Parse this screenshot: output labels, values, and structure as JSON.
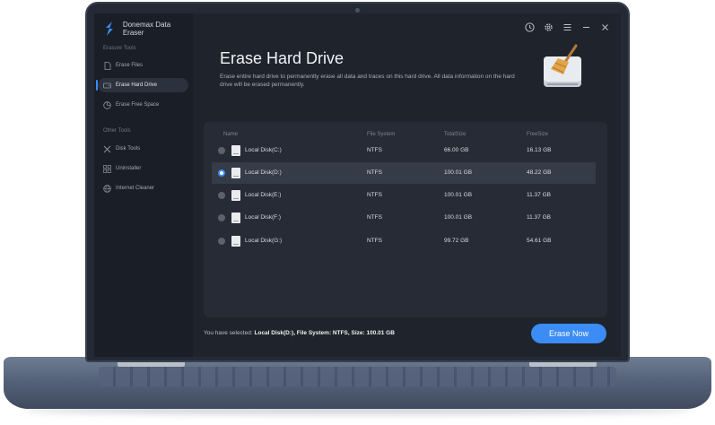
{
  "app": {
    "title": "Donemax Data Eraser"
  },
  "sidebar": {
    "section_erasure": "Erasure Tools",
    "section_other": "Other Tools",
    "erasure_items": [
      {
        "label": "Erase Files",
        "icon": "document-icon",
        "active": false
      },
      {
        "label": "Erase Hard Drive",
        "icon": "drive-icon",
        "active": true
      },
      {
        "label": "Erase Free Space",
        "icon": "pie-chart-icon",
        "active": false
      }
    ],
    "other_items": [
      {
        "label": "Disk Tools",
        "icon": "tools-icon"
      },
      {
        "label": "Uninstaller",
        "icon": "grid-icon"
      },
      {
        "label": "Internet Cleaner",
        "icon": "globe-icon"
      }
    ]
  },
  "toolbar": {
    "icons": [
      "clock-icon",
      "gear-icon",
      "menu-icon",
      "minimize-icon",
      "close-icon"
    ]
  },
  "main": {
    "title": "Erase Hard Drive",
    "description": "Erase entire hard drive to permanently erase all data and traces on this hard drive. All data information on the hard drive will be erased permanently.",
    "hero_icon": "broom-drive-icon"
  },
  "table": {
    "headers": {
      "name": "Name",
      "fs": "File System",
      "total": "TotalSize",
      "free": "FreeSize"
    },
    "rows": [
      {
        "name": "Local Disk(C:)",
        "fs": "NTFS",
        "total": "66.00 GB",
        "free": "16.13 GB",
        "selected": false
      },
      {
        "name": "Local Disk(D:)",
        "fs": "NTFS",
        "total": "100.01 GB",
        "free": "48.22 GB",
        "selected": true
      },
      {
        "name": "Local Disk(E:)",
        "fs": "NTFS",
        "total": "100.01 GB",
        "free": "11.37 GB",
        "selected": false
      },
      {
        "name": "Local Disk(F:)",
        "fs": "NTFS",
        "total": "100.01 GB",
        "free": "11.37 GB",
        "selected": false
      },
      {
        "name": "Local Disk(G:)",
        "fs": "NTFS",
        "total": "99.72 GB",
        "free": "54.61 GB",
        "selected": false
      }
    ]
  },
  "footer": {
    "selected_prefix": "You have selected: ",
    "selected_value": "Local Disk(D:), File System: NTFS, Size: 100.01 GB",
    "erase_button": "Erase Now"
  },
  "colors": {
    "accent": "#3b8cf5",
    "background": "#1f232c",
    "sidebar": "#1a1e27",
    "panel": "#262b35"
  }
}
